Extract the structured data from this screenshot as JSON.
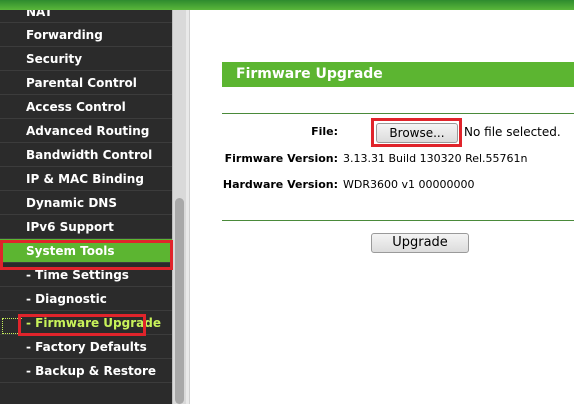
{
  "sidebar": {
    "items": [
      {
        "label": "NAT",
        "type": "main"
      },
      {
        "label": "Forwarding",
        "type": "main"
      },
      {
        "label": "Security",
        "type": "main"
      },
      {
        "label": "Parental Control",
        "type": "main"
      },
      {
        "label": "Access Control",
        "type": "main"
      },
      {
        "label": "Advanced Routing",
        "type": "main"
      },
      {
        "label": "Bandwidth Control",
        "type": "main"
      },
      {
        "label": "IP & MAC Binding",
        "type": "main"
      },
      {
        "label": "Dynamic DNS",
        "type": "main"
      },
      {
        "label": "IPv6 Support",
        "type": "main"
      },
      {
        "label": "System Tools",
        "type": "main-selected"
      },
      {
        "label": "- Time Settings",
        "type": "sub"
      },
      {
        "label": "- Diagnostic",
        "type": "sub"
      },
      {
        "label": "- Firmware Upgrade",
        "type": "sub-active"
      },
      {
        "label": "- Factory Defaults",
        "type": "sub"
      },
      {
        "label": "- Backup & Restore",
        "type": "sub"
      }
    ]
  },
  "main": {
    "section_title": "Firmware Upgrade",
    "file_label": "File:",
    "browse_label": "Browse...",
    "file_status": "No file selected.",
    "firmware_label": "Firmware Version:",
    "firmware_value": "3.13.31 Build 130320 Rel.55761n",
    "hardware_label": "Hardware Version:",
    "hardware_value": "WDR3600 v1 00000000",
    "upgrade_label": "Upgrade"
  },
  "colors": {
    "accent_green": "#5cb531",
    "sidebar_bg": "#2b2b2b",
    "highlight_red": "#e0242b",
    "active_sub_text": "#c8f25a"
  }
}
